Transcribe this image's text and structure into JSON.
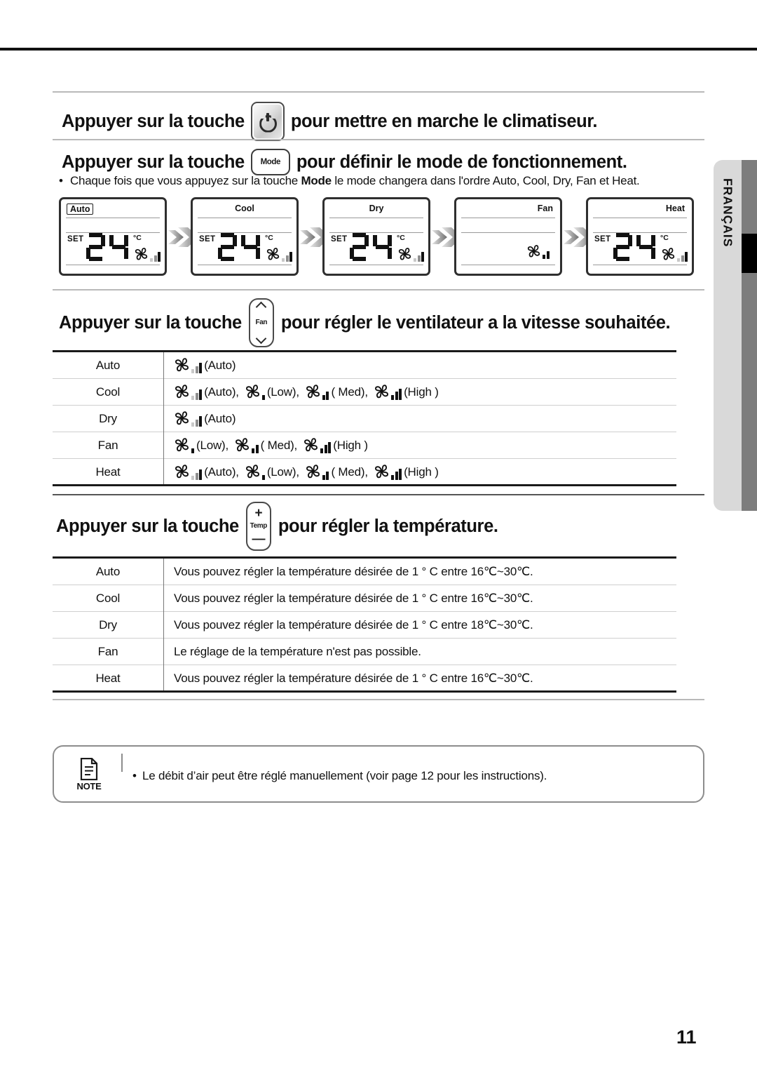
{
  "page": {
    "number": "11",
    "side_tab_language": "FRANÇAIS"
  },
  "sections": {
    "power": {
      "text_before": "Appuyer sur la touche",
      "button_icon": "power-icon",
      "text_after": "pour mettre en marche le climatiseur."
    },
    "mode": {
      "text_before": "Appuyer sur la touche",
      "button_label": "Mode",
      "text_after": "pour définir le mode de fonctionnement.",
      "bullet": {
        "part1": "Chaque fois que vous appuyez sur la touche",
        "bold": "Mode",
        "part2": "le mode changera dans l'ordre Auto, Cool, Dry, Fan et Heat."
      },
      "panels": [
        {
          "label": "Auto",
          "label_style": "boxed",
          "set": "SET",
          "temp": "24",
          "unit": "°C",
          "fan": "auto",
          "has_temp": true
        },
        {
          "label": "Cool",
          "label_style": "center",
          "set": "SET",
          "temp": "24",
          "unit": "°C",
          "fan": "auto",
          "has_temp": true
        },
        {
          "label": "Dry",
          "label_style": "center",
          "set": "SET",
          "temp": "24",
          "unit": "°C",
          "fan": "auto",
          "has_temp": true
        },
        {
          "label": "Fan",
          "label_style": "right",
          "set": "",
          "temp": "",
          "unit": "",
          "fan": "medium",
          "has_temp": false
        },
        {
          "label": "Heat",
          "label_style": "right",
          "set": "SET",
          "temp": "24",
          "unit": "°C",
          "fan": "auto",
          "has_temp": true
        }
      ]
    },
    "fan": {
      "text_before": "Appuyer sur la touche",
      "button_label": "Fan",
      "text_after": "pour régler le ventilateur a la vitesse souhaitée.",
      "rows": [
        {
          "mode": "Auto",
          "speeds": [
            {
              "icon": "auto",
              "label": "(Auto)"
            }
          ]
        },
        {
          "mode": "Cool",
          "speeds": [
            {
              "icon": "auto",
              "label": "(Auto),"
            },
            {
              "icon": "low",
              "label": "(Low),"
            },
            {
              "icon": "medium",
              "label": "( Med),"
            },
            {
              "icon": "high",
              "label": "(High )"
            }
          ]
        },
        {
          "mode": "Dry",
          "speeds": [
            {
              "icon": "auto",
              "label": "(Auto)"
            }
          ]
        },
        {
          "mode": "Fan",
          "speeds": [
            {
              "icon": "low",
              "label": "(Low),"
            },
            {
              "icon": "medium",
              "label": "( Med),"
            },
            {
              "icon": "high",
              "label": "(High )"
            }
          ]
        },
        {
          "mode": "Heat",
          "speeds": [
            {
              "icon": "auto",
              "label": "(Auto),"
            },
            {
              "icon": "low",
              "label": "(Low),"
            },
            {
              "icon": "medium",
              "label": "( Med),"
            },
            {
              "icon": "high",
              "label": "(High )"
            }
          ]
        }
      ]
    },
    "temperature": {
      "text_before": "Appuyer sur la touche",
      "button_plus": "+",
      "button_label": "Temp",
      "button_minus": "—",
      "text_after": "pour régler la température.",
      "rows": [
        {
          "mode": "Auto",
          "desc": "Vous pouvez régler la température désirée de 1 ° C entre 16℃~30℃."
        },
        {
          "mode": "Cool",
          "desc": "Vous pouvez régler la température désirée de 1 ° C entre 16℃~30℃."
        },
        {
          "mode": "Dry",
          "desc": "Vous pouvez régler la température désirée de 1 ° C entre 18℃~30℃."
        },
        {
          "mode": "Fan",
          "desc": "Le réglage de la température n'est pas possible."
        },
        {
          "mode": "Heat",
          "desc": "Vous pouvez régler la température désirée de 1 ° C entre 16℃~30℃."
        }
      ]
    },
    "note": {
      "label": "NOTE",
      "text": "Le débit d’air peut être réglé manuellement (voir page 12 pour les instructions)."
    }
  }
}
